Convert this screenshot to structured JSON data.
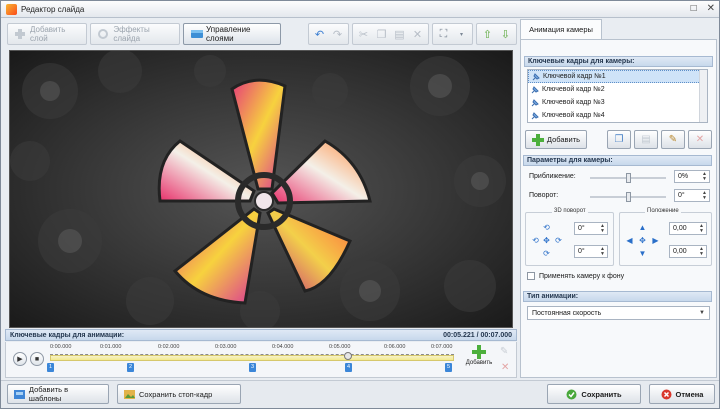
{
  "window": {
    "title": "Редактор слайда"
  },
  "toolbar": {
    "add_layer": "Добавить слой",
    "slide_effects": "Эффекты слайда",
    "layer_control": "Управление слоями"
  },
  "timeline": {
    "title": "Ключевые кадры для анимации:",
    "time_display": "00:05.221 / 00:07.000",
    "ticks": [
      "0:00.000",
      "0:01.000",
      "0:02.000",
      "0:03.000",
      "0:04.000",
      "0:05.000",
      "0:06.000",
      "0:07.000"
    ],
    "markers": [
      "1",
      "2",
      "3",
      "4",
      "5"
    ],
    "add_label": "Добавить"
  },
  "bottom": {
    "add_template": "Добавить в шаблоны",
    "save_frame": "Сохранить стоп-кадр",
    "save": "Сохранить",
    "cancel": "Отмена"
  },
  "panel": {
    "tab": "Анимация камеры",
    "keyframes_header": "Ключевые кадры для камеры:",
    "keyframes": [
      "Ключевой кадр №1",
      "Ключевой кадр №2",
      "Ключевой кадр №3",
      "Ключевой кадр №4"
    ],
    "add_button": "Добавить",
    "params_header": "Параметры для камеры:",
    "zoom_label": "Приближение:",
    "zoom_value": "0%",
    "rotation_label": "Поворот:",
    "rotation_value": "0°",
    "rotate3d_title": "3D поворот",
    "rot3d_x": "0°",
    "rot3d_y": "0°",
    "position_title": "Положение",
    "pos_x": "0,00",
    "pos_y": "0,00",
    "apply_bg": "Применять камеру к фону",
    "anim_type_header": "Тип анимации:",
    "anim_type_value": "Постоянная скорость"
  },
  "colors": {
    "accent": "#3b86d8",
    "header_bg": "#c7d8ec",
    "track": "#f3ea8d"
  }
}
